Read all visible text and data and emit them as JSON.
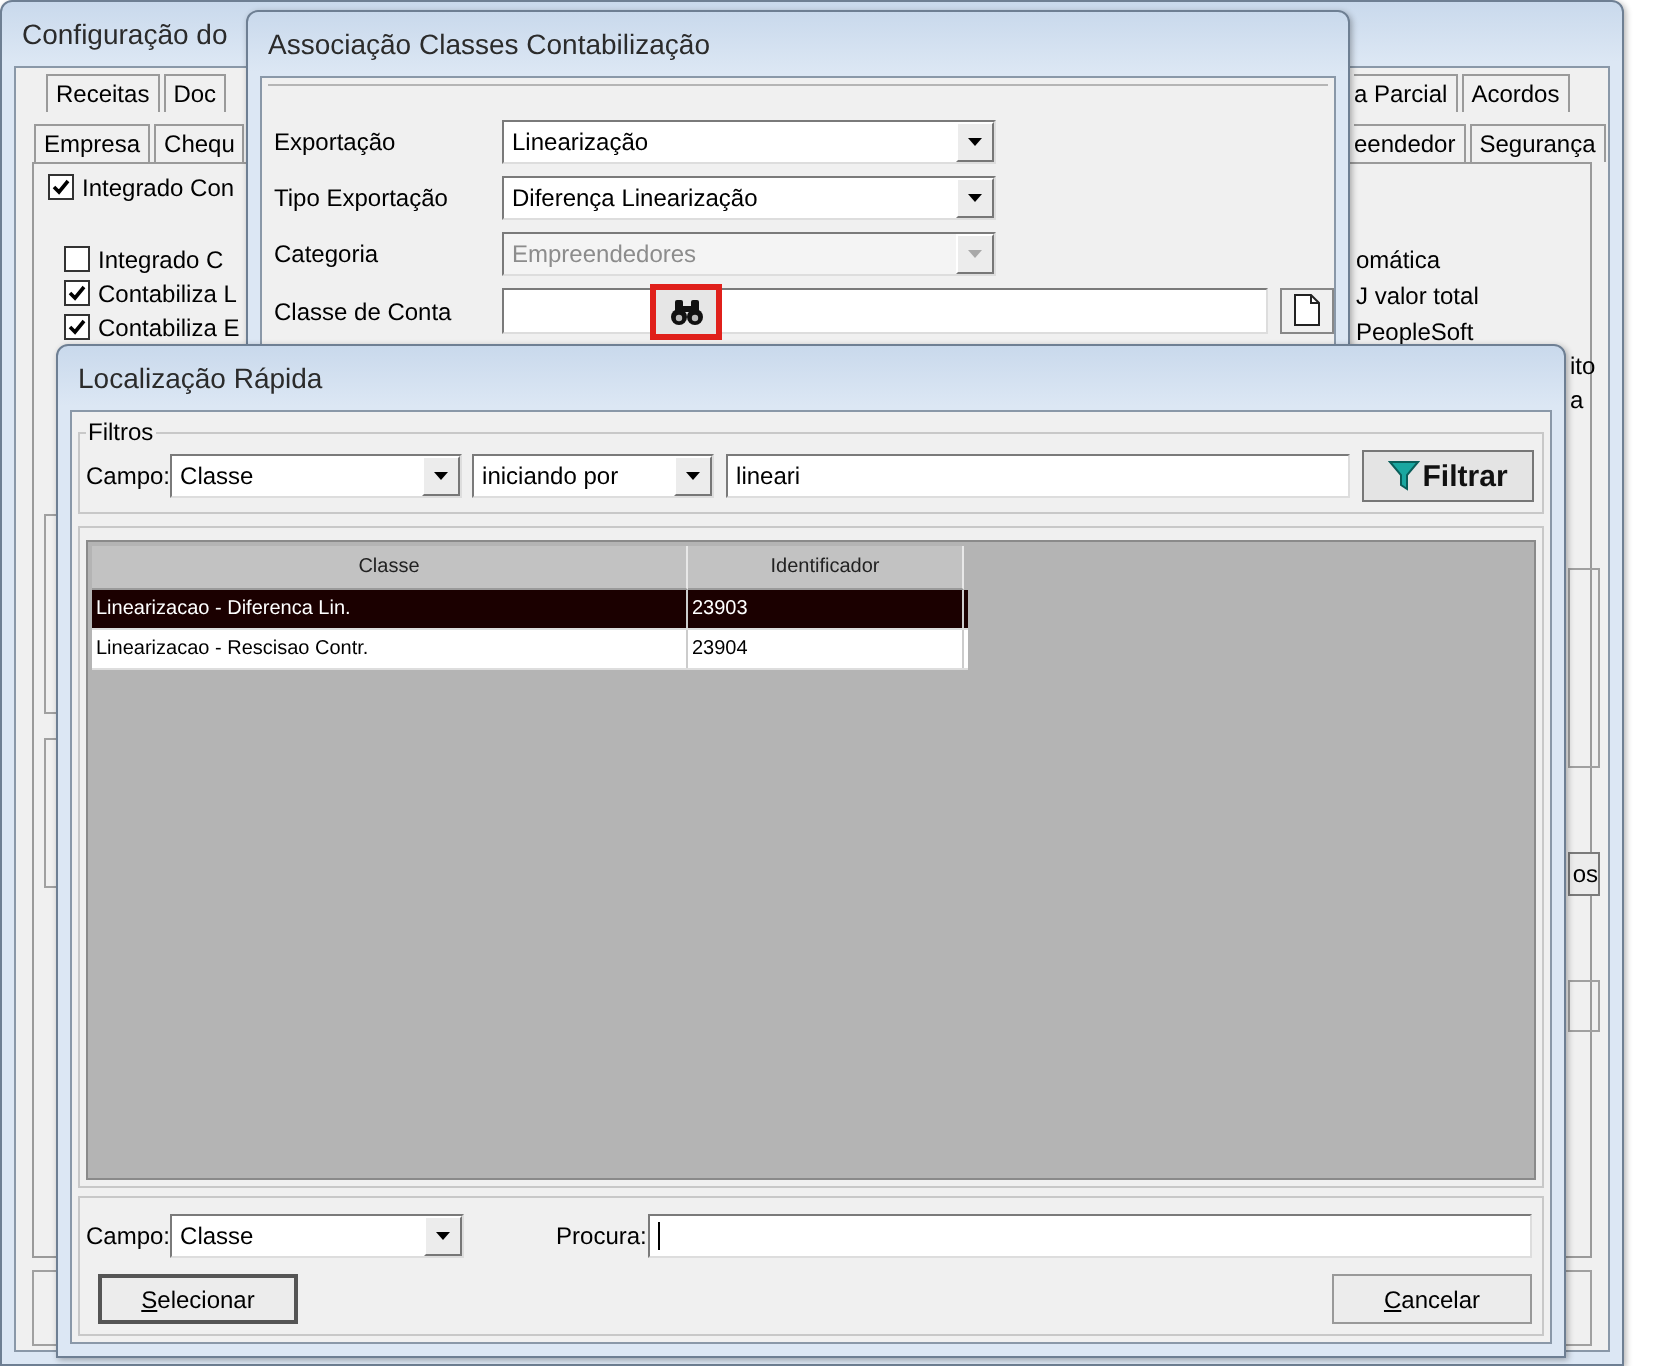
{
  "background_window": {
    "title": "Configuração do",
    "tabs_row_1": {
      "left": [
        {
          "label": "Receitas",
          "selected": false
        },
        {
          "label": "Doc",
          "selected": false
        }
      ],
      "right": [
        {
          "label": "a Parcial",
          "selected": false
        },
        {
          "label": "Acordos",
          "selected": false
        }
      ]
    },
    "tabs_row_2": {
      "left": [
        {
          "label": "Empresa",
          "selected": false
        },
        {
          "label": "Chequ",
          "selected": false
        }
      ],
      "right": [
        {
          "label": "eendedor",
          "selected": false
        },
        {
          "label": "Segurança",
          "selected": false
        }
      ]
    },
    "main_checkbox": {
      "label": "Integrado Con",
      "checked": true
    },
    "checkboxes": [
      {
        "label": "Integrado C",
        "checked": false
      },
      {
        "label": "Contabiliza L",
        "checked": true
      },
      {
        "label": "Contabiliza E",
        "checked": true
      }
    ],
    "right_texts": [
      "omática",
      "J valor total",
      "PeopleSoft"
    ],
    "edge_texts": [
      "ito",
      "a"
    ],
    "edge_button": "os"
  },
  "association_dialog": {
    "title": "Associação Classes Contabilização",
    "fields": [
      {
        "label": "Exportação",
        "kind": "combo",
        "value": "Linearização",
        "disabled": false
      },
      {
        "label": "Tipo Exportação",
        "kind": "combo",
        "value": "Diferença Linearização",
        "disabled": false
      },
      {
        "label": "Categoria",
        "kind": "combo",
        "value": "Empreendedores",
        "disabled": true
      },
      {
        "label": "Classe de Conta",
        "kind": "lookup",
        "highlighted": true
      }
    ]
  },
  "quick_search": {
    "title": "Localização Rápida",
    "filters": {
      "title": "Filtros",
      "field_label": "Campo:",
      "field": "Classe",
      "operator": "iniciando por",
      "value": "lineari",
      "button": "Filtrar"
    },
    "table": {
      "columns": [
        "Classe",
        "Identificador"
      ],
      "rows": [
        {
          "cells": [
            "Linearizacao - Diferenca Lin.",
            "23903"
          ],
          "selected": true
        },
        {
          "cells": [
            "Linearizacao - Rescisao Contr.",
            "23904"
          ],
          "selected": false
        }
      ]
    },
    "search": {
      "field_label": "Campo:",
      "field": "Classe",
      "label": "Procura:",
      "focused": true
    },
    "buttons": [
      {
        "label": "Selecionar",
        "kind": "default"
      },
      {
        "label": "Cancelar",
        "kind": "normal"
      }
    ]
  }
}
